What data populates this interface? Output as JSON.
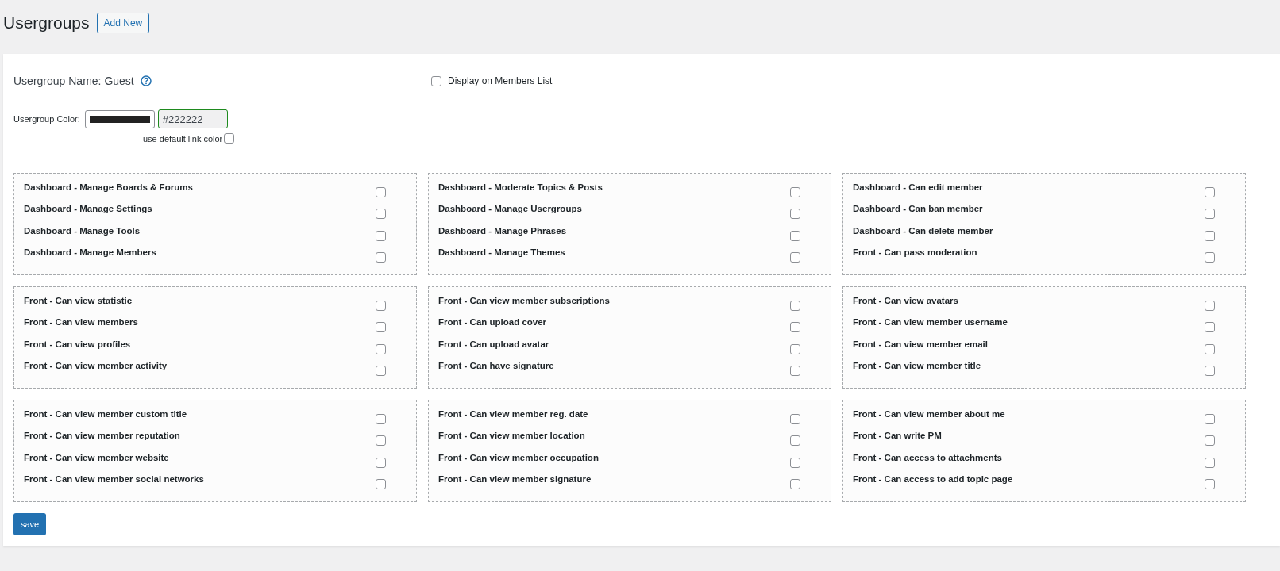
{
  "header": {
    "title": "Usergroups",
    "add_button": "Add New"
  },
  "form": {
    "name_label": "Usergroup Name: Guest",
    "display_on_members": {
      "label": "Display on Members List",
      "checked": false
    },
    "color_label": "Usergroup Color:",
    "color_value": "#222222",
    "default_link_color": {
      "label": "use default link color",
      "checked": false
    }
  },
  "permission_groups": [
    {
      "items": [
        {
          "label": "Dashboard - Manage Boards & Forums",
          "checked": false
        },
        {
          "label": "Dashboard - Manage Settings",
          "checked": false
        },
        {
          "label": "Dashboard - Manage Tools",
          "checked": false
        },
        {
          "label": "Dashboard - Manage Members",
          "checked": false
        }
      ]
    },
    {
      "items": [
        {
          "label": "Dashboard - Moderate Topics & Posts",
          "checked": false
        },
        {
          "label": "Dashboard - Manage Usergroups",
          "checked": false
        },
        {
          "label": "Dashboard - Manage Phrases",
          "checked": false
        },
        {
          "label": "Dashboard - Manage Themes",
          "checked": false
        }
      ]
    },
    {
      "items": [
        {
          "label": "Dashboard - Can edit member",
          "checked": false
        },
        {
          "label": "Dashboard - Can ban member",
          "checked": false
        },
        {
          "label": "Dashboard - Can delete member",
          "checked": false
        },
        {
          "label": "Front - Can pass moderation",
          "checked": false
        }
      ]
    },
    {
      "items": [
        {
          "label": "Front - Can view statistic",
          "checked": false
        },
        {
          "label": "Front - Can view members",
          "checked": false
        },
        {
          "label": "Front - Can view profiles",
          "checked": false
        },
        {
          "label": "Front - Can view member activity",
          "checked": false
        }
      ]
    },
    {
      "items": [
        {
          "label": "Front - Can view member subscriptions",
          "checked": false
        },
        {
          "label": "Front - Can upload cover",
          "checked": false
        },
        {
          "label": "Front - Can upload avatar",
          "checked": false
        },
        {
          "label": "Front - Can have signature",
          "checked": false
        }
      ]
    },
    {
      "items": [
        {
          "label": "Front - Can view avatars",
          "checked": false
        },
        {
          "label": "Front - Can view member username",
          "checked": false
        },
        {
          "label": "Front - Can view member email",
          "checked": false
        },
        {
          "label": "Front - Can view member title",
          "checked": false
        }
      ]
    },
    {
      "items": [
        {
          "label": "Front - Can view member custom title",
          "checked": false
        },
        {
          "label": "Front - Can view member reputation",
          "checked": false
        },
        {
          "label": "Front - Can view member website",
          "checked": false
        },
        {
          "label": "Front - Can view member social networks",
          "checked": false
        }
      ]
    },
    {
      "items": [
        {
          "label": "Front - Can view member reg. date",
          "checked": false
        },
        {
          "label": "Front - Can view member location",
          "checked": false
        },
        {
          "label": "Front - Can view member occupation",
          "checked": false
        },
        {
          "label": "Front - Can view member signature",
          "checked": false
        }
      ]
    },
    {
      "items": [
        {
          "label": "Front - Can view member about me",
          "checked": false
        },
        {
          "label": "Front - Can write PM",
          "checked": false
        },
        {
          "label": "Front - Can access to attachments",
          "checked": false
        },
        {
          "label": "Front - Can access to add topic page",
          "checked": false
        }
      ]
    }
  ],
  "save_button": "save"
}
